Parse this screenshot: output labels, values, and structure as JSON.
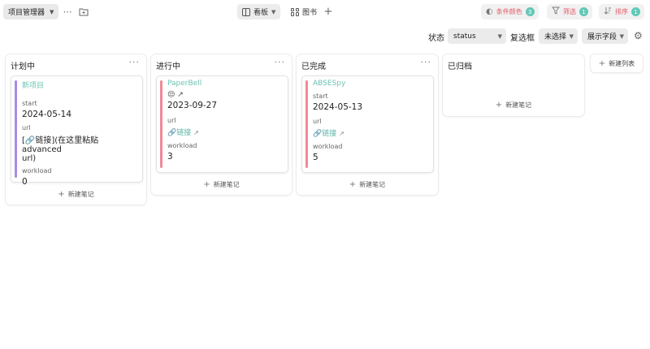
{
  "toolbar": {
    "project_button": "项目管理器",
    "more_icon": "more-horizontal-icon",
    "folder_icon": "folder-plus-icon",
    "views": [
      {
        "label": "看板",
        "icon": "kanban-icon",
        "active": true
      },
      {
        "label": "图书",
        "icon": "grid-icon",
        "active": false
      }
    ],
    "add_view_icon": "plus-icon",
    "pills": [
      {
        "label": "条件颜色",
        "count": "3",
        "icon": "palette-icon"
      },
      {
        "label": "筛选",
        "count": "1",
        "icon": "filter-icon"
      },
      {
        "label": "排序",
        "count": "1",
        "icon": "sort-icon"
      }
    ]
  },
  "filterbar": {
    "status_label": "状态",
    "status_value": "status",
    "checkbox_label": "复选框",
    "checkbox_value": "未选择",
    "fields_button": "展示字段",
    "settings_icon": "gear-icon"
  },
  "columns": [
    {
      "title": "计划中",
      "cards": [
        {
          "title": "新项目",
          "bar_color": "#a98be8",
          "start_label": "start",
          "start_value": "2024-05-14",
          "url_label": "url",
          "url_value_line1": "[🔗链接](在这里粘贴 advanced",
          "url_value_line2": "url)",
          "workload_label": "workload",
          "workload_value": "0"
        }
      ],
      "new_note": "新建笔记"
    },
    {
      "title": "进行中",
      "cards": [
        {
          "title": "PaperBell",
          "bar_color": "#ef8a96",
          "emoji_row": "😒 ↗",
          "start_value": "2023-09-27",
          "url_label": "url",
          "url_link": "🔗链接",
          "workload_label": "workload",
          "workload_value": "3"
        }
      ],
      "new_note": "新建笔记"
    },
    {
      "title": "已完成",
      "cards": [
        {
          "title": "ABSESpy",
          "bar_color": "#ef8a96",
          "start_label": "start",
          "start_value": "2024-05-13",
          "url_label": "url",
          "url_link": "🔗链接",
          "workload_label": "workload",
          "workload_value": "5"
        }
      ],
      "new_note": "新建笔记"
    },
    {
      "title": "已归档",
      "cards": [],
      "new_note": "新建笔记"
    }
  ],
  "new_list": "新建列表",
  "colors": {
    "accent_teal": "#63c8b6",
    "pill_text": "#e25b6a"
  }
}
